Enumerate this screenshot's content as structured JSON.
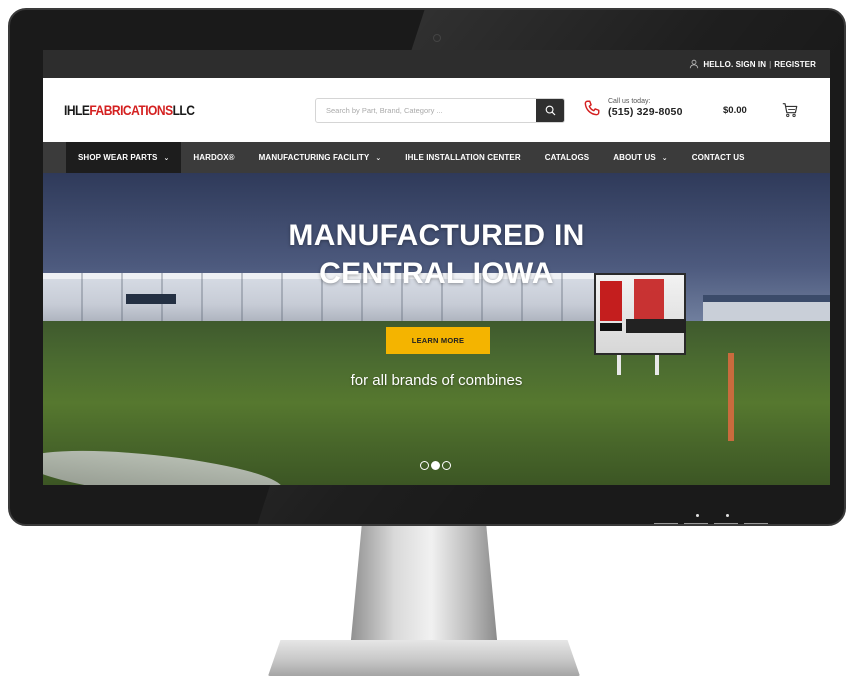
{
  "topbar": {
    "sign_in": "HELLO. SIGN IN",
    "separator": "|",
    "register": "REGISTER"
  },
  "header": {
    "logo_part1": "IHLE",
    "logo_part2": "FABRICATIONS",
    "logo_part3": "LLC",
    "search_placeholder": "Search by Part, Brand, Category ...",
    "call_label": "Call us today:",
    "phone": "(515) 329-8050",
    "cart_total": "$0.00"
  },
  "nav": {
    "items": [
      {
        "label": "SHOP WEAR PARTS",
        "chevron": "⌄"
      },
      {
        "label": "HARDOX®"
      },
      {
        "label": "MANUFACTURING FACILITY",
        "chevron": "⌄"
      },
      {
        "label": "IHLE INSTALLATION CENTER"
      },
      {
        "label": "CATALOGS"
      },
      {
        "label": "ABOUT US",
        "chevron": "⌄"
      },
      {
        "label": "CONTACT US"
      }
    ]
  },
  "hero": {
    "title_line1": "MANUFACTURED IN",
    "title_line2": "CENTRAL IOWA",
    "cta": "LEARN MORE",
    "subtitle": "for all brands of combines",
    "slide_count": 3,
    "active_slide": 2
  },
  "colors": {
    "accent_red": "#d42020",
    "cta_yellow": "#f4b400",
    "nav_bg": "#3b3b3b",
    "topbar_bg": "#2d2d2d"
  },
  "icons": {
    "user": "user-icon",
    "search": "search-icon",
    "phone": "phone-icon",
    "cart": "cart-icon"
  }
}
